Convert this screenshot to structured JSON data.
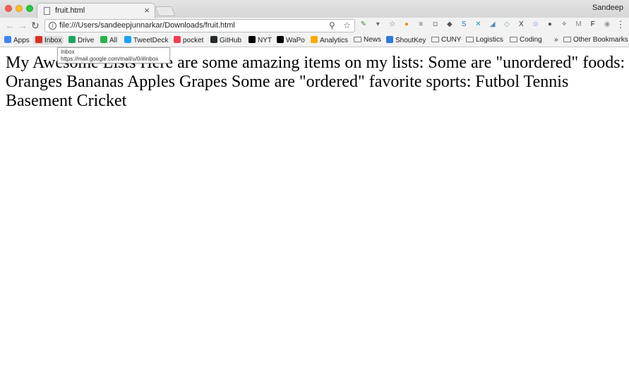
{
  "browser": {
    "tab_title": "fruit.html",
    "tab_close": "×",
    "profile_name": "Sandeep",
    "url": "file:///Users/sandeepjunnarkar/Downloads/fruit.html",
    "info_icon": "i",
    "nav": {
      "back": "←",
      "forward": "→",
      "reload": "↻"
    },
    "zoom_icon": "⚲",
    "star_icon": "☆",
    "menu_icon": "⋮"
  },
  "bookmarks": {
    "items": [
      {
        "label": "Apps",
        "icon": "apps-icon",
        "color": "#4285f4"
      },
      {
        "label": "Inbox",
        "icon": "gmail-icon",
        "color": "#d93025"
      },
      {
        "label": "Drive",
        "icon": "drive-icon",
        "color": "#1fa463"
      },
      {
        "label": "All",
        "icon": "feedly-icon",
        "color": "#2bb24c"
      },
      {
        "label": "TweetDeck",
        "icon": "tweetdeck-icon",
        "color": "#1da1f2"
      },
      {
        "label": "pocket",
        "icon": "pocket-icon",
        "color": "#ef4056"
      },
      {
        "label": "GitHub",
        "icon": "github-icon",
        "color": "#24292e"
      },
      {
        "label": "NYT",
        "icon": "nyt-icon",
        "color": "#000000"
      },
      {
        "label": "WaPo",
        "icon": "wapo-icon",
        "color": "#000000"
      },
      {
        "label": "Analytics",
        "icon": "analytics-icon",
        "color": "#f9ab00"
      },
      {
        "label": "News",
        "icon": "folder-icon",
        "color": "#777777"
      },
      {
        "label": "ShoutKey",
        "icon": "shoutkey-icon",
        "color": "#2d7bd8"
      },
      {
        "label": "CUNY",
        "icon": "folder-icon",
        "color": "#777777"
      },
      {
        "label": "Logistics",
        "icon": "folder-icon",
        "color": "#777777"
      },
      {
        "label": "Coding",
        "icon": "folder-icon",
        "color": "#777777"
      }
    ],
    "overflow": "»",
    "other": "Other Bookmarks"
  },
  "tooltip": {
    "title": "Inbox",
    "url": "https://mail.google.com/mail/u/0/#inbox"
  },
  "page": {
    "text": "My Awesome Lists Here are some amazing items on my lists: Some are \"unordered\" foods: Oranges Bananas Apples Grapes Some are \"ordered\" favorite sports: Futbol Tennis Basement Cricket"
  },
  "extensions": [
    "pen-icon",
    "pocket-ext-icon",
    "star-ext-icon",
    "orange-ext-icon",
    "list-icon",
    "camera-icon",
    "shield-icon",
    "s-icon",
    "x-icon",
    "kangaroo-icon",
    "dropbox-icon",
    "x-box-icon",
    "robot-icon",
    "ball-icon",
    "arrow-icon",
    "m-icon",
    "f-icon",
    "globe-icon"
  ]
}
